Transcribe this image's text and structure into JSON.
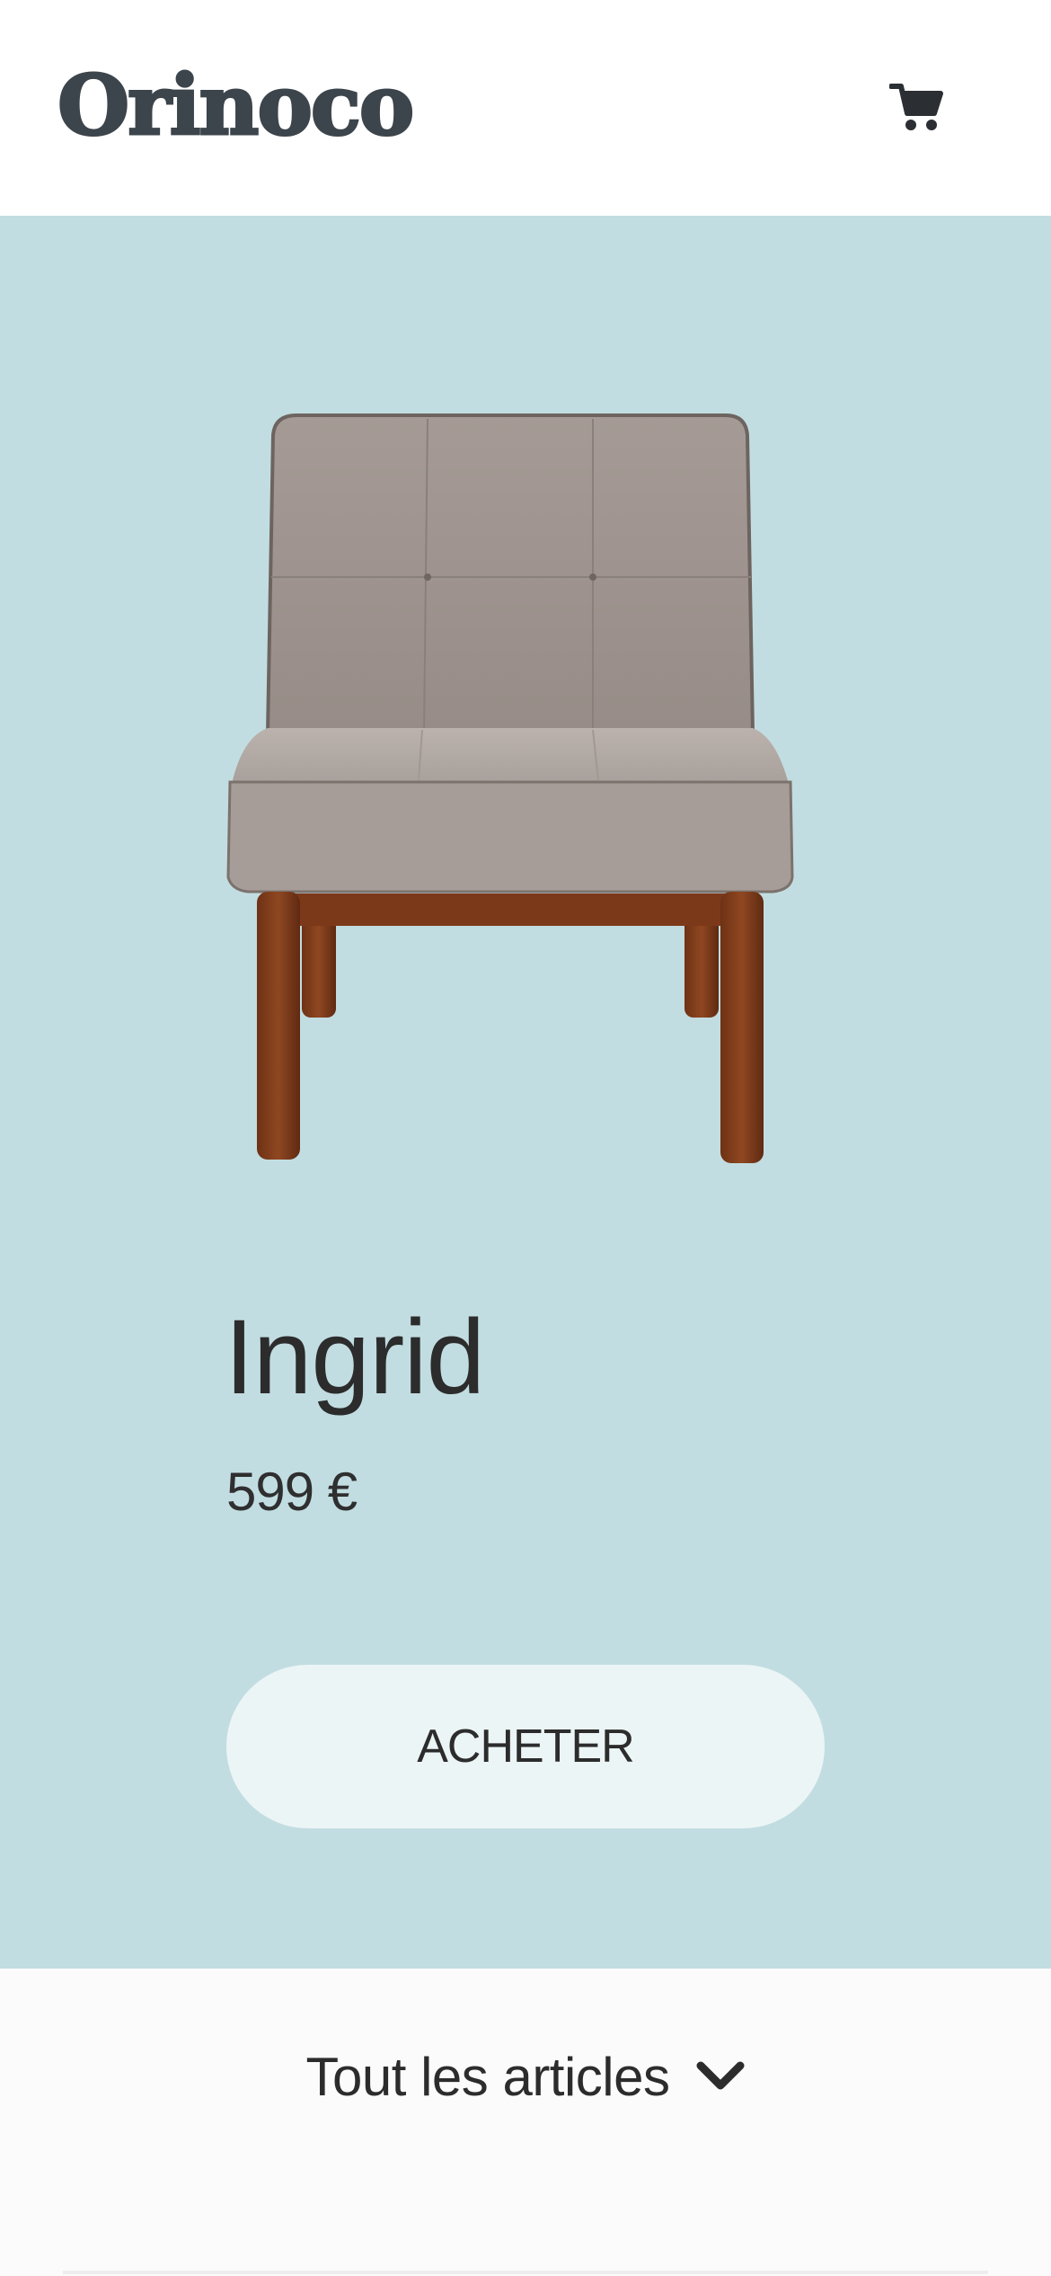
{
  "header": {
    "logo_text": "Orinoco",
    "cart_icon": "shopping-cart-icon"
  },
  "product": {
    "name": "Ingrid",
    "price": "599 €",
    "image_icon": "upholstered-chair-image",
    "buy_label": "ACHETER"
  },
  "articles": {
    "label": "Tout les articles",
    "toggle_icon": "chevron-down-icon"
  },
  "colors": {
    "hero_bg": "#c2dde1",
    "button_bg": "#ecf5f6",
    "logo": "#3c444c"
  }
}
